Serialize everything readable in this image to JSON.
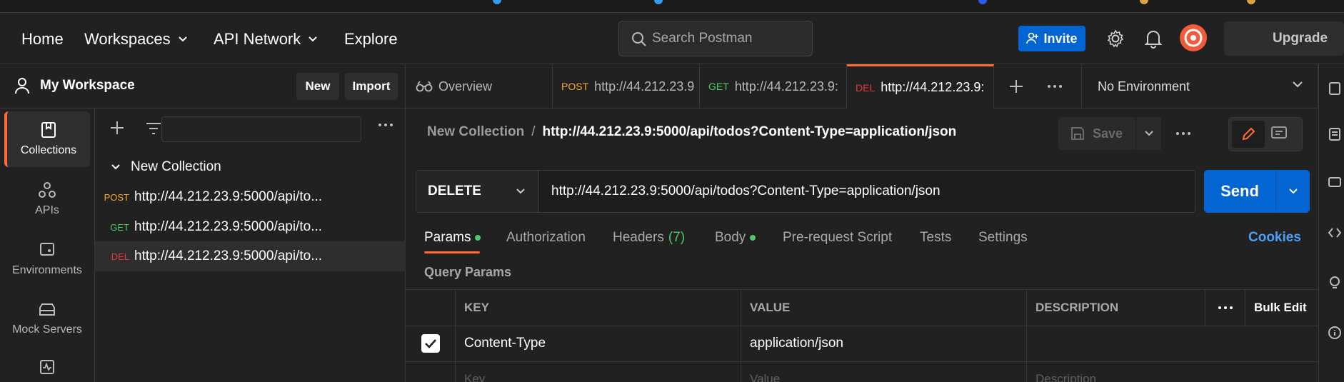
{
  "header": {
    "nav": [
      "Home",
      "Workspaces",
      "API Network",
      "Explore"
    ],
    "search_placeholder": "Search Postman",
    "invite_label": "Invite",
    "upgrade_label": "Upgrade"
  },
  "workspace": {
    "title": "My Workspace",
    "new_label": "New",
    "import_label": "Import"
  },
  "rail": {
    "items": [
      "Collections",
      "APIs",
      "Environments",
      "Mock Servers"
    ]
  },
  "tree": {
    "collection": "New Collection",
    "requests": [
      {
        "method": "POST",
        "url": "http://44.212.23.9:5000/api/to...",
        "color": "#f9a825"
      },
      {
        "method": "GET",
        "url": "http://44.212.23.9:5000/api/to...",
        "color": "#49cc67"
      },
      {
        "method": "DEL",
        "url": "http://44.212.23.9:5000/api/to...",
        "color": "#e53935"
      }
    ]
  },
  "tabs": {
    "overview": "Overview",
    "items": [
      {
        "method": "POST",
        "url": "http://44.212.23.9"
      },
      {
        "method": "GET",
        "url": "http://44.212.23.9:"
      },
      {
        "method": "DEL",
        "url": "http://44.212.23.9:"
      }
    ],
    "environment": "No Environment"
  },
  "request": {
    "breadcrumb_parent": "New Collection",
    "breadcrumb_separator": "/",
    "title": "http://44.212.23.9:5000/api/todos?Content-Type=application/json",
    "save_label": "Save",
    "method": "DELETE",
    "url": "http://44.212.23.9:5000/api/todos?Content-Type=application/json",
    "send_label": "Send"
  },
  "request_tabs": {
    "params": "Params",
    "authorization": "Authorization",
    "headers": "Headers",
    "headers_count": "(7)",
    "body": "Body",
    "prerequest": "Pre-request Script",
    "tests": "Tests",
    "settings": "Settings",
    "cookies": "Cookies"
  },
  "params": {
    "section_label": "Query Params",
    "columns": {
      "key": "KEY",
      "value": "VALUE",
      "description": "DESCRIPTION",
      "bulk_edit": "Bulk Edit"
    },
    "rows": [
      {
        "key": "Content-Type",
        "value": "application/json",
        "description": "",
        "checked": true
      }
    ],
    "placeholder": {
      "key": "Key",
      "value": "Value",
      "description": "Description"
    }
  },
  "colors": {
    "accent": "#ff6c37",
    "primary": "#0265d2",
    "link": "#4aa0f7",
    "post": "#f9a825",
    "get": "#49cc67",
    "del": "#e53935"
  }
}
